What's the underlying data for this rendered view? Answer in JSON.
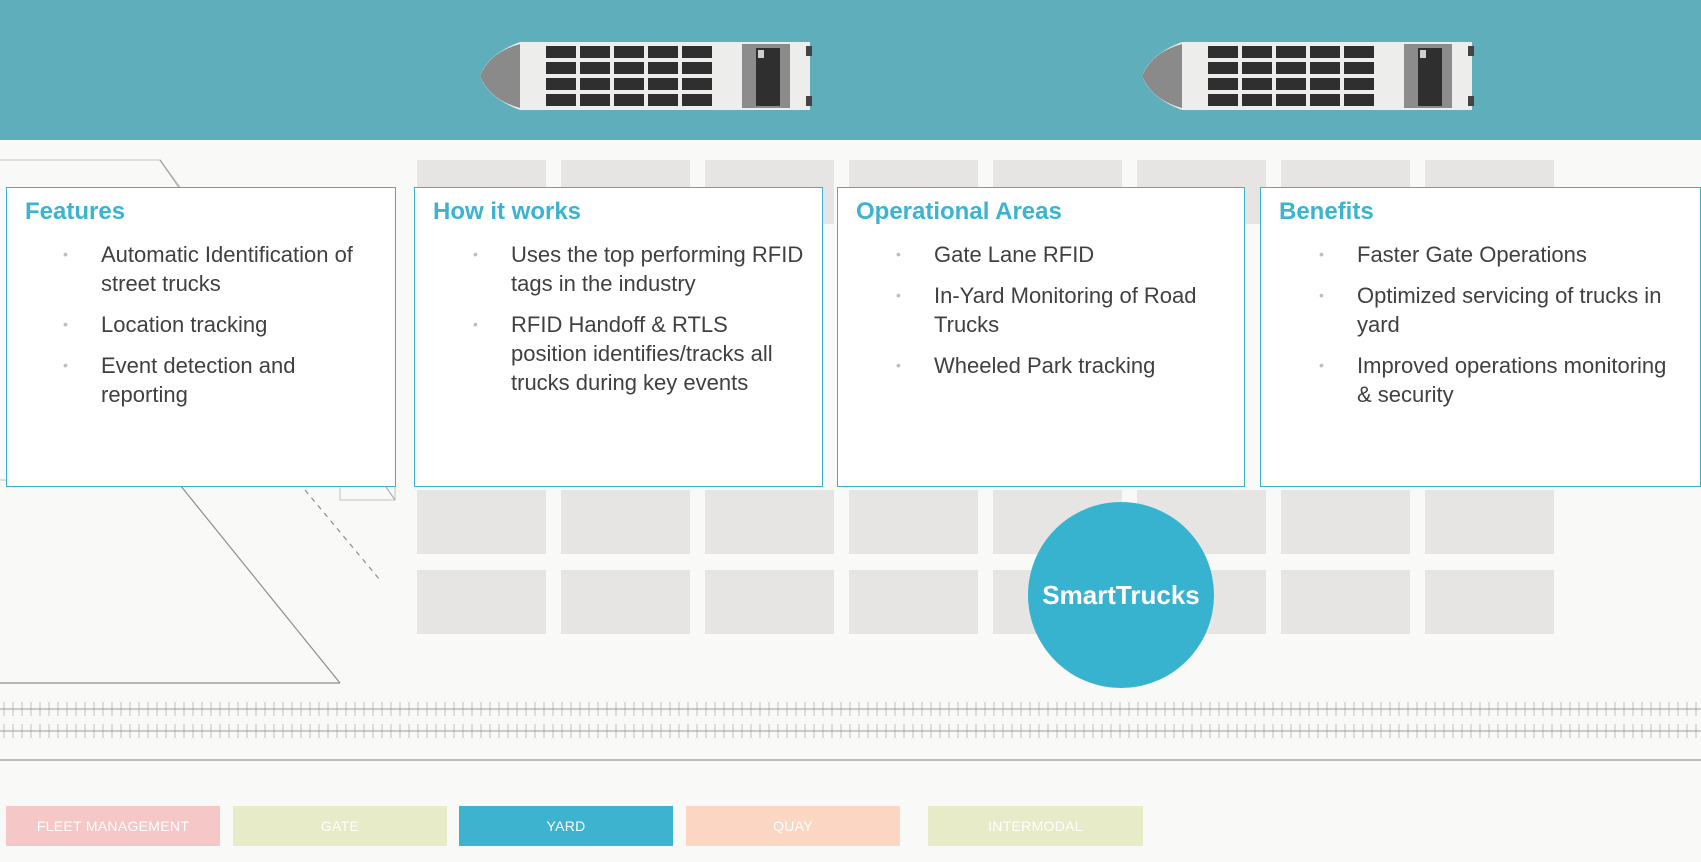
{
  "colors": {
    "water": "#5eaebc",
    "accent": "#3cb3cf",
    "card_border": "#39b2cc",
    "text": "#404040",
    "tab_fleet": "#f5c7c7",
    "tab_gate": "#e8ebc7",
    "tab_yard": "#3db3cf",
    "tab_quay": "#fbd6c2",
    "tab_intermodal": "#e8ebc7"
  },
  "cards": [
    {
      "title": "Features",
      "items": [
        "Automatic Identification of street trucks",
        "Location tracking",
        "Event detection and reporting"
      ]
    },
    {
      "title": "How it works",
      "items": [
        "Uses the top performing RFID tags in the industry",
        "RFID Handoff & RTLS position identifies/tracks all trucks during key events"
      ]
    },
    {
      "title": "Operational Areas",
      "items": [
        "Gate Lane RFID",
        "In-Yard Monitoring of Road Trucks",
        "Wheeled Park tracking"
      ]
    },
    {
      "title": "Benefits",
      "items": [
        "Faster Gate Operations",
        "Optimized servicing of trucks in yard",
        "Improved operations monitoring & security"
      ]
    }
  ],
  "badge": "SmartTrucks",
  "tabs": [
    {
      "label": "FLEET MANAGEMENT",
      "active": false
    },
    {
      "label": "GATE",
      "active": false
    },
    {
      "label": "YARD",
      "active": true
    },
    {
      "label": "QUAY",
      "active": false
    },
    {
      "label": "INTERMODAL",
      "active": false
    }
  ]
}
